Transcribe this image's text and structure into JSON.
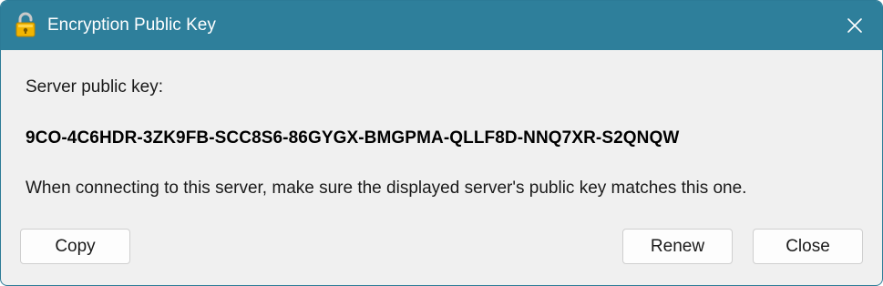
{
  "window": {
    "title": "Encryption Public Key",
    "title_icon": "padlock-icon",
    "close_icon": "close-icon",
    "accent_color": "#2e7f9b"
  },
  "content": {
    "label": "Server public key:",
    "public_key": "9CO-4C6HDR-3ZK9FB-SCC8S6-86GYGX-BMGPMA-QLLF8D-NNQ7XR-S2QNQW",
    "note": "When connecting to this server, make sure the displayed server's public key matches this one."
  },
  "buttons": {
    "copy": "Copy",
    "renew": "Renew",
    "close": "Close"
  }
}
